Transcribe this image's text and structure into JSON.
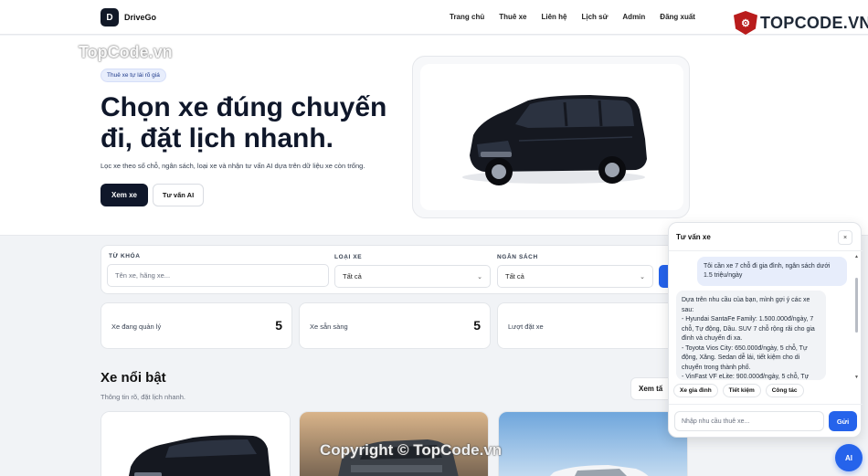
{
  "header": {
    "brand_initial": "D",
    "brand_name": "DriveGo",
    "nav": [
      "Trang chủ",
      "Thuê xe",
      "Liên hệ",
      "Lịch sử",
      "Admin",
      "Đăng xuất"
    ]
  },
  "watermark": {
    "logo_text": "TOPCODE.VN",
    "top_text": "TopCode.vn",
    "bottom_text": "Copyright © TopCode.vn"
  },
  "hero": {
    "badge": "Thuê xe tự lái rõ giá",
    "title": "Chọn xe đúng chuyến đi, đặt lịch nhanh.",
    "subtitle": "Lọc xe theo số chỗ, ngân sách, loại xe và nhận tư vấn AI dựa trên dữ liệu xe còn trống.",
    "primary_button": "Xem xe",
    "secondary_button": "Tư vấn AI"
  },
  "filter": {
    "keyword_label": "TỪ KHÓA",
    "keyword_placeholder": "Tên xe, hãng xe...",
    "type_label": "LOẠI XE",
    "type_value": "Tất cả",
    "budget_label": "NGÂN SÁCH",
    "budget_value": "Tất cả"
  },
  "stats": [
    {
      "label": "Xe đang quản lý",
      "value": "5"
    },
    {
      "label": "Xe sẵn sàng",
      "value": "5"
    },
    {
      "label": "Lượt đặt xe",
      "value": ""
    }
  ],
  "featured": {
    "title": "Xe nổi bật",
    "subtitle": "Thông tin rõ, đặt lịch nhanh.",
    "see_all": "Xem tấ"
  },
  "chat": {
    "title": "Tư vấn xe",
    "close": "×",
    "user_message": "Tôi cần xe 7 chỗ đi gia đình, ngân sách dưới 1.5 triệu/ngày",
    "bot_message": "Dựa trên nhu cầu của bạn, mình gợi ý các xe sau:\n- Hyundai SantaFe Family: 1.500.000đ/ngày, 7 chỗ, Tự động, Dầu. SUV 7 chỗ rộng rãi cho gia đình và chuyến đi xa.\n- Toyota Vios City: 650.000đ/ngày, 5 chỗ, Tự động, Xăng. Sedan dễ lái, tiết kiệm cho di chuyển trong thành phố.\n- VinFast VF eLite: 900.000đ/ngày, 5 chỗ, Tự",
    "chips": [
      "Xe gia đình",
      "Tiết kiệm",
      "Công tác"
    ],
    "input_placeholder": "Nhập nhu cầu thuê xe...",
    "send": "Gửi",
    "fab": "AI"
  },
  "colors": {
    "primary": "#2563eb",
    "dark": "#0f172a",
    "page_bg": "#f1f3f6"
  }
}
